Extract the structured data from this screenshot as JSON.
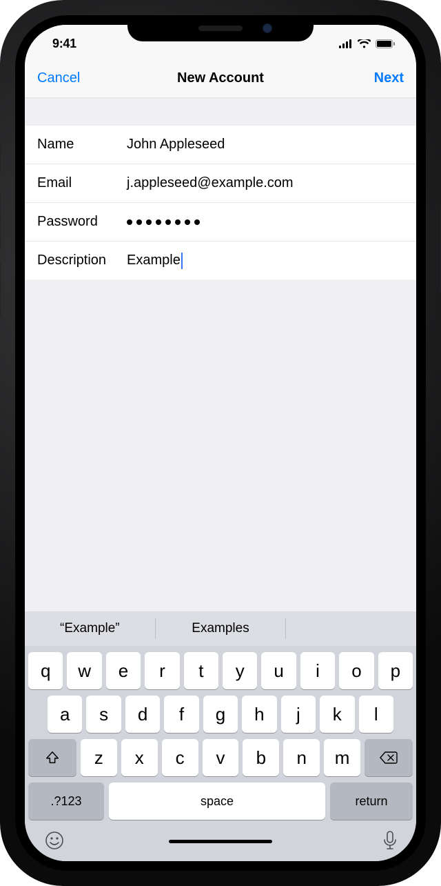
{
  "status": {
    "time": "9:41"
  },
  "nav": {
    "cancel": "Cancel",
    "title": "New Account",
    "next": "Next"
  },
  "form": {
    "name_label": "Name",
    "name_value": "John Appleseed",
    "email_label": "Email",
    "email_value": "j.appleseed@example.com",
    "password_label": "Password",
    "password_value": "••••••••",
    "description_label": "Description",
    "description_value": "Example"
  },
  "suggestions": {
    "s1": "“Example”",
    "s2": "Examples"
  },
  "keys": {
    "row1": [
      "q",
      "w",
      "e",
      "r",
      "t",
      "y",
      "u",
      "i",
      "o",
      "p"
    ],
    "row2": [
      "a",
      "s",
      "d",
      "f",
      "g",
      "h",
      "j",
      "k",
      "l"
    ],
    "row3": [
      "z",
      "x",
      "c",
      "v",
      "b",
      "n",
      "m"
    ],
    "num": ".?123",
    "space": "space",
    "return": "return"
  }
}
